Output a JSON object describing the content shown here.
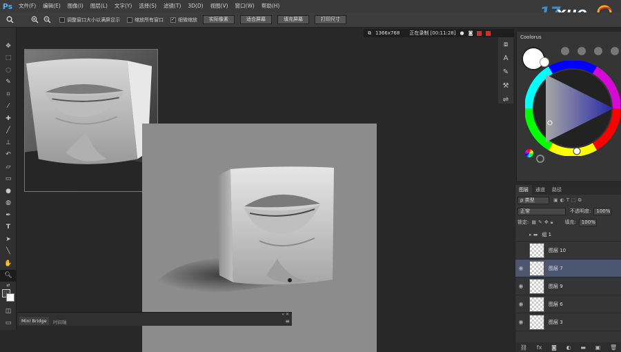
{
  "app": {
    "logo": "Ps",
    "menus": [
      "文件(F)",
      "编辑(E)",
      "图像(I)",
      "图层(L)",
      "文字(Y)",
      "选择(S)",
      "滤镜(T)",
      "3D(D)",
      "视图(V)",
      "窗口(W)",
      "帮助(H)"
    ],
    "brand": "17xue"
  },
  "options_bar": {
    "tool_icon": "zoom-icon",
    "checkbox_resize": "调整窗口大小以满屏显示",
    "checkbox_all_windows": "缩放所有窗口",
    "checkbox_scrubby": "细微缩放",
    "buttons": [
      "实际像素",
      "适合屏幕",
      "填充屏幕",
      "打印尺寸"
    ]
  },
  "doc_status": {
    "resolution": "1366x768",
    "recording": "正在录制 [00:11:28]"
  },
  "bottom_panel": {
    "tab_active": "Mini Bridge",
    "tab_other": "时间轴"
  },
  "color_panel": {
    "title": "Coolorus"
  },
  "layers_panel": {
    "tabs": [
      "图层",
      "通道",
      "路径"
    ],
    "filter_label": "ρ 类型",
    "blend_mode": "正常",
    "opacity_label": "不透明度:",
    "opacity_value": "100%",
    "lock_label": "锁定:",
    "fill_label": "填充:",
    "fill_value": "100%",
    "layers": [
      {
        "name": "组 1",
        "type": "group",
        "visible": false
      },
      {
        "name": "图层 10",
        "visible": false
      },
      {
        "name": "图层 7",
        "visible": true,
        "selected": true
      },
      {
        "name": "图层 9",
        "visible": true
      },
      {
        "name": "图层 6",
        "visible": true
      },
      {
        "name": "图层 3",
        "visible": true
      }
    ]
  }
}
